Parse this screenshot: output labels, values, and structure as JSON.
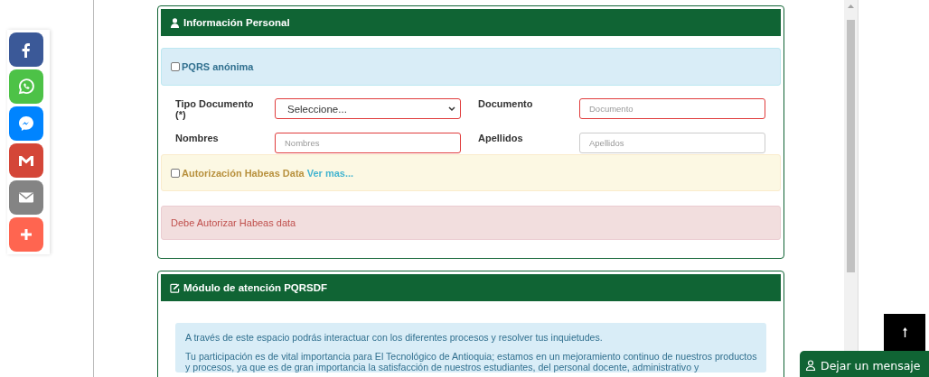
{
  "share_buttons": [
    {
      "kind": "facebook",
      "color": "#3b5998"
    },
    {
      "kind": "whatsapp",
      "color": "#4dc247"
    },
    {
      "kind": "messenger",
      "color": "#0084ff"
    },
    {
      "kind": "gmail",
      "color": "#d44638"
    },
    {
      "kind": "email",
      "color": "#848484"
    },
    {
      "kind": "more",
      "color": "#ff6550"
    }
  ],
  "personal_info": {
    "title": "Información Personal",
    "anonymous": {
      "label": "PQRS anónima",
      "checked": false
    },
    "fields": [
      {
        "label": "Tipo Documento",
        "required_mark": "(*)",
        "kind": "select",
        "value": "Seleccione...",
        "invalid": true
      },
      {
        "label": "Documento",
        "kind": "input",
        "placeholder": "Documento",
        "invalid": true
      },
      {
        "label": "Nombres",
        "kind": "input",
        "placeholder": "Nombres",
        "invalid": true
      },
      {
        "label": "Apellidos",
        "kind": "input",
        "placeholder": "Apellidos",
        "invalid": false
      }
    ],
    "habeas": {
      "label": "Autorización Habeas Data",
      "link": "Ver mas...",
      "checked": false
    },
    "error": "Debe Autorizar Habeas data"
  },
  "module": {
    "title": "Módulo de atención PQRSDF",
    "paragraphs": [
      "A través de este espacio podrás interactuar con los diferentes procesos y resolver tus inquietudes.",
      "Tu participación es de vital importancia para El Tecnológico de Antioquia; estamos en un mejoramiento continuo de nuestros productos y procesos, ya que es de gran importancia la satisfacción de nuestros estudiantes, del personal docente, administrativo y"
    ]
  },
  "chat": {
    "label": "Dejar un mensaje"
  }
}
